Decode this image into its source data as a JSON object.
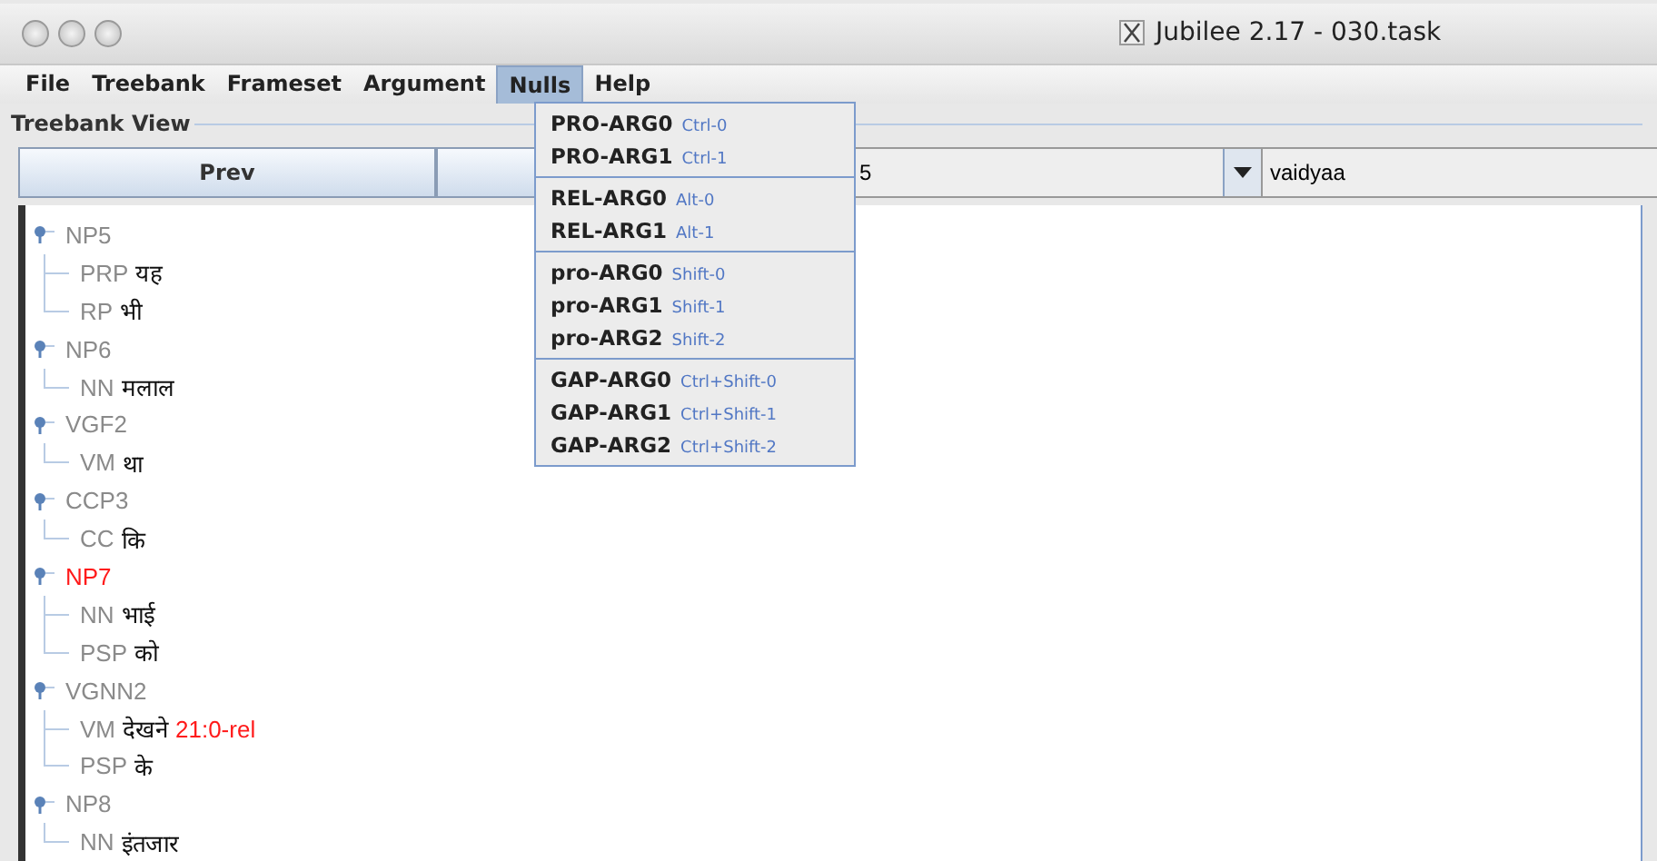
{
  "window": {
    "title": "Jubilee 2.17 - 030.task"
  },
  "menus": [
    {
      "label": "File",
      "selected": false
    },
    {
      "label": "Treebank",
      "selected": false
    },
    {
      "label": "Frameset",
      "selected": false
    },
    {
      "label": "Argument",
      "selected": false
    },
    {
      "label": "Nulls",
      "selected": true
    },
    {
      "label": "Help",
      "selected": false
    }
  ],
  "dropdown": {
    "groups": [
      [
        {
          "label": "PRO-ARG0",
          "shortcut": "Ctrl-0"
        },
        {
          "label": "PRO-ARG1",
          "shortcut": "Ctrl-1"
        }
      ],
      [
        {
          "label": "REL-ARG0",
          "shortcut": "Alt-0"
        },
        {
          "label": "REL-ARG1",
          "shortcut": "Alt-1"
        }
      ],
      [
        {
          "label": "pro-ARG0",
          "shortcut": "Shift-0"
        },
        {
          "label": "pro-ARG1",
          "shortcut": "Shift-1"
        },
        {
          "label": "pro-ARG2",
          "shortcut": "Shift-2"
        }
      ],
      [
        {
          "label": "GAP-ARG0",
          "shortcut": "Ctrl+Shift-0"
        },
        {
          "label": "GAP-ARG1",
          "shortcut": "Ctrl+Shift-1"
        },
        {
          "label": "GAP-ARG2",
          "shortcut": "Ctrl+Shift-2"
        }
      ]
    ]
  },
  "panel": {
    "title": "Treebank View"
  },
  "toolbar": {
    "prev_button": "Prev",
    "sentence_combo": "5",
    "user_field": "vaidyaa"
  },
  "tree": [
    {
      "label": "NP5",
      "color": "#8a8a8a",
      "expanded": true,
      "children": [
        {
          "tag": "PRP",
          "word": "यह"
        },
        {
          "tag": "RP",
          "word": "भी"
        }
      ]
    },
    {
      "label": "NP6",
      "color": "#8a8a8a",
      "expanded": true,
      "children": [
        {
          "tag": "NN",
          "word": "मलाल"
        }
      ]
    },
    {
      "label": "VGF2",
      "color": "#8a8a8a",
      "expanded": true,
      "children": [
        {
          "tag": "VM",
          "word": "था"
        }
      ]
    },
    {
      "label": "CCP3",
      "color": "#8a8a8a",
      "expanded": true,
      "children": [
        {
          "tag": "CC",
          "word": "कि"
        }
      ]
    },
    {
      "label": "NP7",
      "color": "#ff1a1a",
      "expanded": true,
      "children": [
        {
          "tag": "NN",
          "word": "भाई"
        },
        {
          "tag": "PSP",
          "word": "को"
        }
      ]
    },
    {
      "label": "VGNN2",
      "color": "#8a8a8a",
      "expanded": true,
      "children": [
        {
          "tag": "VM",
          "word": "देखने",
          "annotation": "21:0-rel"
        },
        {
          "tag": "PSP",
          "word": "के"
        }
      ]
    },
    {
      "label": "NP8",
      "color": "#8a8a8a",
      "expanded": true,
      "children": [
        {
          "tag": "NN",
          "word": "इंतजार"
        }
      ]
    }
  ]
}
